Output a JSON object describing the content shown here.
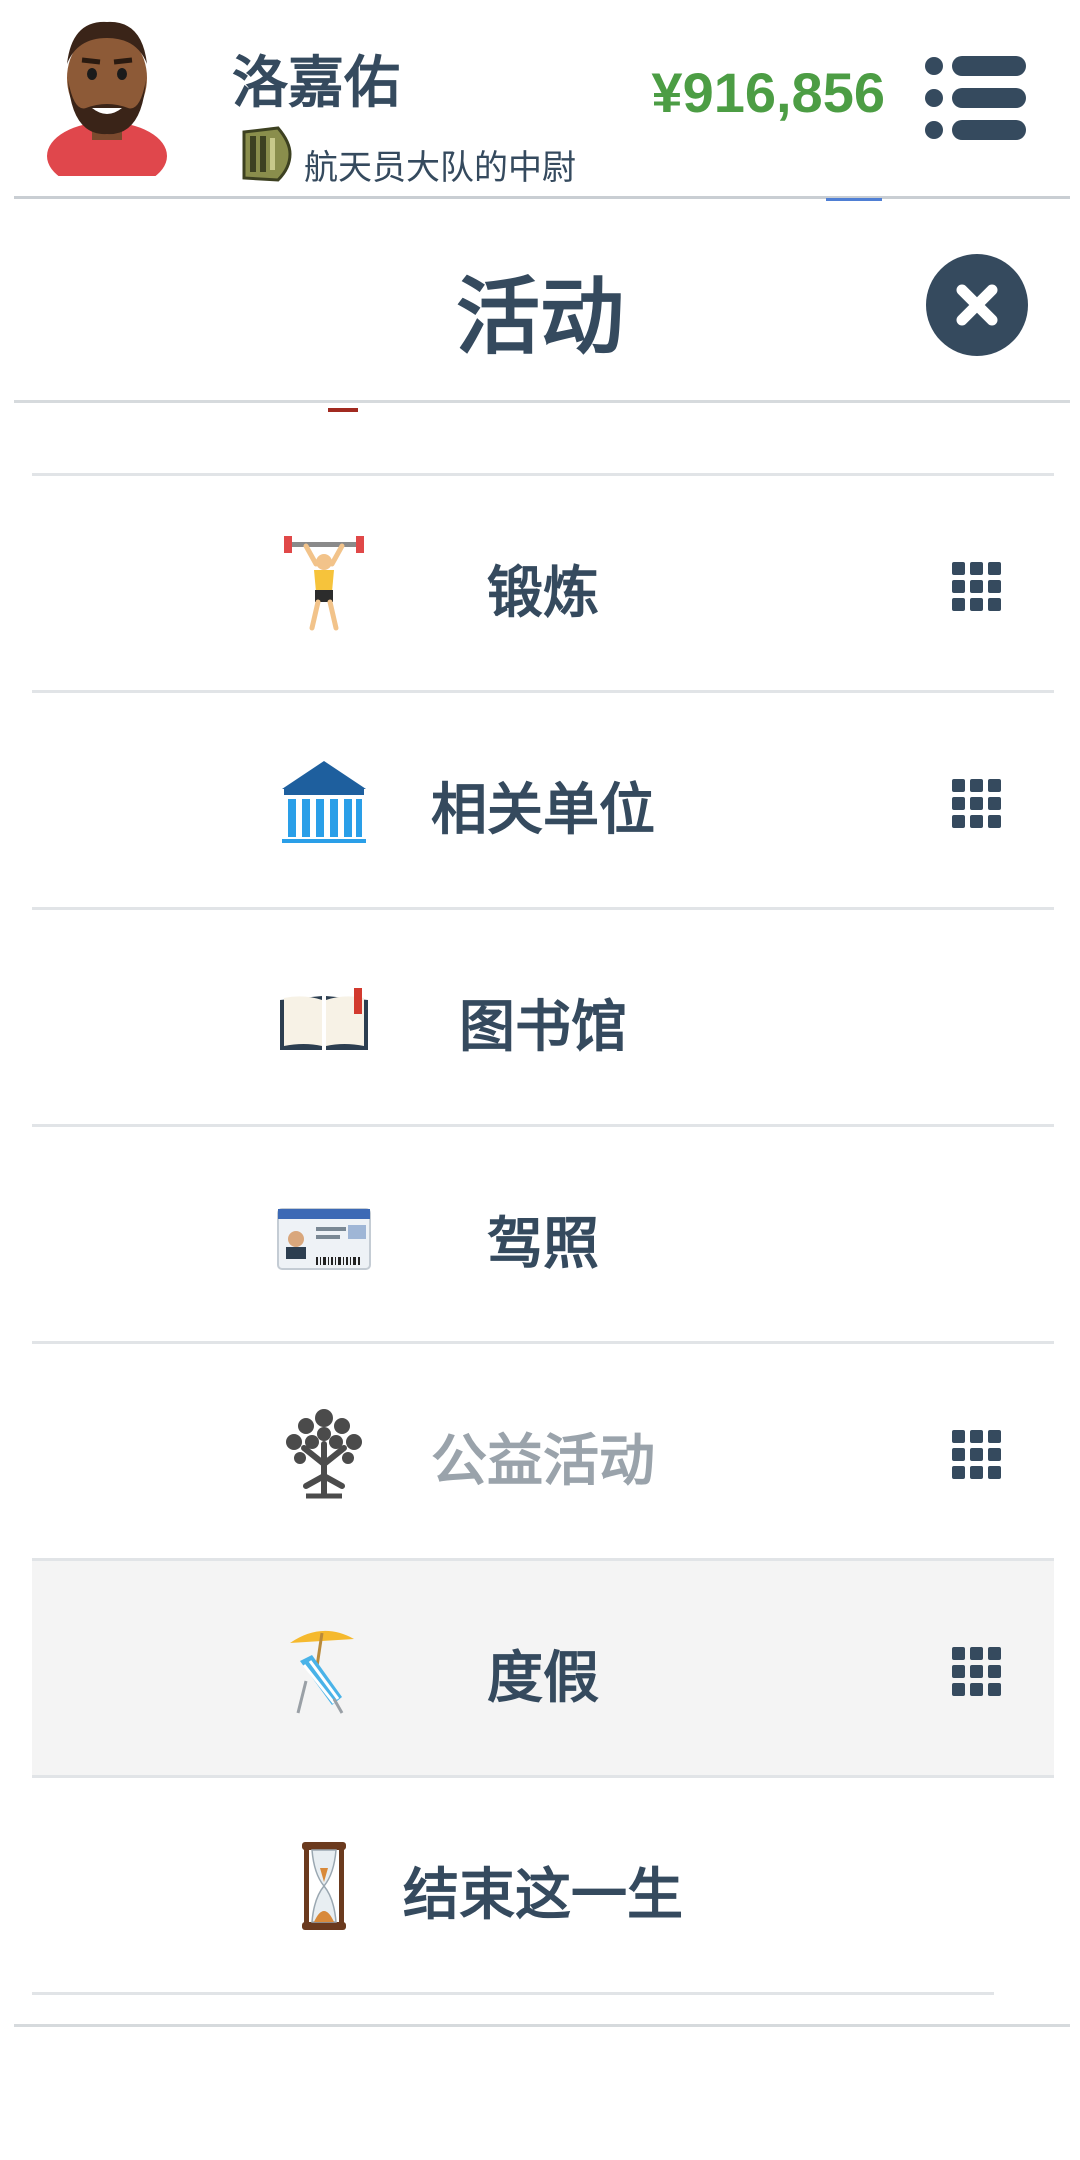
{
  "header": {
    "player_name": "洛嘉佑",
    "rank_title": "航天员大队的中尉",
    "money": "¥916,856",
    "avatar_icon": "bearded-man-avatar",
    "rank_icon": "military-rank-icon",
    "menu_icon": "list-menu-icon"
  },
  "modal": {
    "title": "活动",
    "close_icon": "close-icon"
  },
  "activities": [
    {
      "label": "锻炼",
      "icon": "weightlifter-icon",
      "has_grid": true,
      "muted": false,
      "highlight": false
    },
    {
      "label": "相关单位",
      "icon": "institution-building-icon",
      "has_grid": true,
      "muted": false,
      "highlight": false
    },
    {
      "label": "图书馆",
      "icon": "open-book-icon",
      "has_grid": false,
      "muted": false,
      "highlight": false
    },
    {
      "label": "驾照",
      "icon": "driver-license-icon",
      "has_grid": false,
      "muted": false,
      "highlight": false
    },
    {
      "label": "公益活动",
      "icon": "charity-tree-icon",
      "has_grid": true,
      "muted": true,
      "highlight": false
    },
    {
      "label": "度假",
      "icon": "beach-chair-umbrella-icon",
      "has_grid": true,
      "muted": false,
      "highlight": true
    },
    {
      "label": "结束这一生",
      "icon": "hourglass-icon",
      "has_grid": false,
      "muted": false,
      "highlight": false
    }
  ],
  "colors": {
    "text": "#354a5e",
    "money": "#4c9d44",
    "muted": "#9aa3ab",
    "highlight_bg": "#f4f4f4"
  }
}
